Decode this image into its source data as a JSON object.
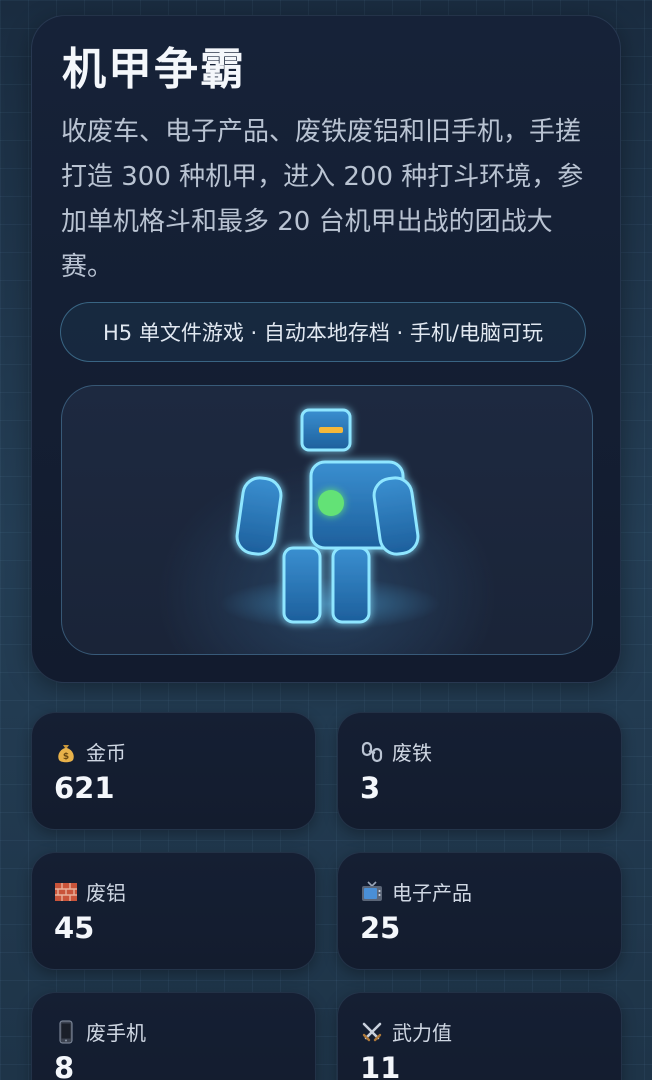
{
  "game": {
    "title": "机甲争霸",
    "description": "收废车、电子产品、废铁废铝和旧手机，手搓打造 300 种机甲，进入 200 种打斗环境，参加单机格斗和最多 20 台机甲出战的团战大赛。",
    "tag": "H5 单文件游戏 · 自动本地存档 · 手机/电脑可玩"
  },
  "stats": [
    {
      "icon": "money-bag-icon",
      "label": "金币",
      "value": "621"
    },
    {
      "icon": "chain-icon",
      "label": "废铁",
      "value": "3"
    },
    {
      "icon": "bricks-icon",
      "label": "废铝",
      "value": "45"
    },
    {
      "icon": "tv-icon",
      "label": "电子产品",
      "value": "25"
    },
    {
      "icon": "mobile-phone-icon",
      "label": "废手机",
      "value": "8"
    },
    {
      "icon": "crossed-swords-icon",
      "label": "武力值",
      "value": "11"
    }
  ],
  "colors": {
    "accent_cyan": "#7fe3ff",
    "robot_core": "#63e276",
    "robot_visor": "#f5b83a"
  }
}
